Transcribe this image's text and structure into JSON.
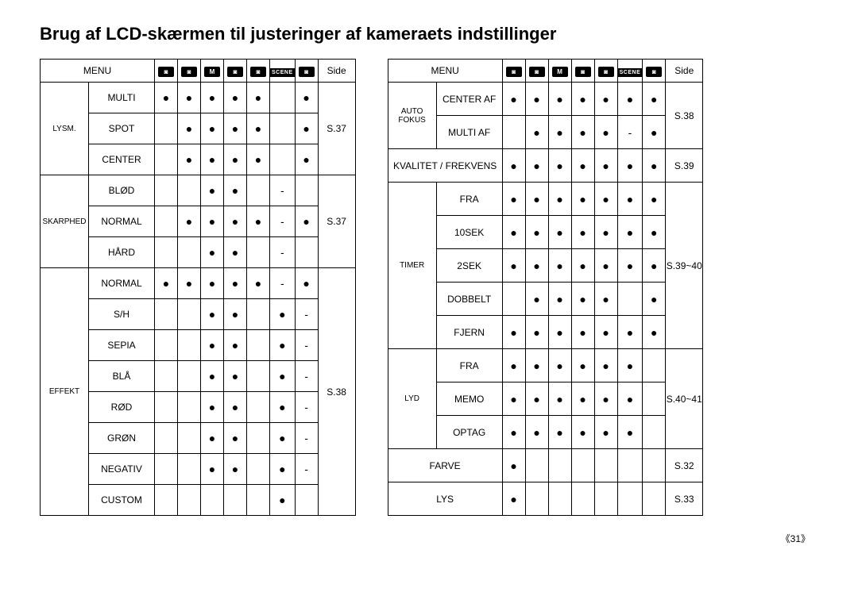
{
  "title": "Brug af LCD-skærmen til justeringer af kameraets indstillinger",
  "header": {
    "menu": "MENU",
    "icons": [
      "◙",
      "◙",
      "M",
      "◙",
      "◙",
      "SCENE",
      "◙"
    ],
    "side": "Side"
  },
  "left": {
    "groups": [
      {
        "cat": "LYSM.",
        "side": "S.37",
        "rows": [
          {
            "name": "MULTI",
            "cells": [
              "●",
              "●",
              "●",
              "●",
              "●",
              "",
              "●"
            ]
          },
          {
            "name": "SPOT",
            "cells": [
              "",
              "●",
              "●",
              "●",
              "●",
              "",
              "●"
            ]
          },
          {
            "name": "CENTER",
            "cells": [
              "",
              "●",
              "●",
              "●",
              "●",
              "",
              "●"
            ]
          }
        ]
      },
      {
        "cat": "SKARPHED",
        "side": "S.37",
        "rows": [
          {
            "name": "BLØD",
            "cells": [
              "",
              "",
              "●",
              "●",
              "",
              "-",
              ""
            ]
          },
          {
            "name": "NORMAL",
            "cells": [
              "",
              "●",
              "●",
              "●",
              "●",
              "-",
              "●"
            ]
          },
          {
            "name": "HÅRD",
            "cells": [
              "",
              "",
              "●",
              "●",
              "",
              "-",
              ""
            ]
          }
        ]
      },
      {
        "cat": "EFFEKT",
        "side": "S.38",
        "rows": [
          {
            "name": "NORMAL",
            "cells": [
              "●",
              "●",
              "●",
              "●",
              "●",
              "-",
              "●"
            ]
          },
          {
            "name": "S/H",
            "cells": [
              "",
              "",
              "●",
              "●",
              "",
              "●",
              "-",
              "●"
            ]
          },
          {
            "name": "SEPIA",
            "cells": [
              "",
              "",
              "●",
              "●",
              "",
              "●",
              "-",
              "●"
            ]
          },
          {
            "name": "BLÅ",
            "cells": [
              "",
              "",
              "●",
              "●",
              "",
              "●",
              "-",
              "●"
            ]
          },
          {
            "name": "RØD",
            "cells": [
              "",
              "",
              "●",
              "●",
              "",
              "●",
              "-",
              "●"
            ]
          },
          {
            "name": "GRØN",
            "cells": [
              "",
              "",
              "●",
              "●",
              "",
              "●",
              "-",
              "●"
            ]
          },
          {
            "name": "NEGATIV",
            "cells": [
              "",
              "",
              "●",
              "●",
              "",
              "●",
              "-",
              "●"
            ]
          },
          {
            "name": "CUSTOM",
            "cells": [
              "",
              "",
              "",
              "",
              "",
              "●",
              "",
              ""
            ]
          }
        ]
      }
    ]
  },
  "right": {
    "groups": [
      {
        "cat": "AUTO FOKUS",
        "side": "S.38",
        "rows": [
          {
            "name": "CENTER AF",
            "cells": [
              "●",
              "●",
              "●",
              "●",
              "●",
              "●",
              "●"
            ]
          },
          {
            "name": "MULTI AF",
            "cells": [
              "",
              "●",
              "●",
              "●",
              "●",
              "-",
              "●"
            ]
          }
        ]
      },
      {
        "cat": "",
        "side": "S.39",
        "full": true,
        "rows": [
          {
            "name": "KVALITET / FREKVENS",
            "cells": [
              "●",
              "●",
              "●",
              "●",
              "●",
              "●",
              "●"
            ]
          }
        ]
      },
      {
        "cat": "TIMER",
        "side": "S.39~40",
        "rows": [
          {
            "name": "FRA",
            "cells": [
              "●",
              "●",
              "●",
              "●",
              "●",
              "●",
              "●"
            ]
          },
          {
            "name": "10SEK",
            "cells": [
              "●",
              "●",
              "●",
              "●",
              "●",
              "●",
              "●"
            ]
          },
          {
            "name": "2SEK",
            "cells": [
              "●",
              "●",
              "●",
              "●",
              "●",
              "●",
              "●"
            ]
          },
          {
            "name": "DOBBELT",
            "cells": [
              "",
              "●",
              "●",
              "●",
              "●",
              "",
              "●"
            ]
          },
          {
            "name": "FJERN",
            "cells": [
              "●",
              "●",
              "●",
              "●",
              "●",
              "●",
              "●"
            ]
          }
        ]
      },
      {
        "cat": "LYD",
        "side": "S.40~41",
        "rows": [
          {
            "name": "FRA",
            "cells": [
              "●",
              "●",
              "●",
              "●",
              "●",
              "●",
              ""
            ]
          },
          {
            "name": "MEMO",
            "cells": [
              "●",
              "●",
              "●",
              "●",
              "●",
              "●",
              ""
            ]
          },
          {
            "name": "OPTAG",
            "cells": [
              "●",
              "●",
              "●",
              "●",
              "●",
              "●",
              ""
            ]
          }
        ]
      },
      {
        "cat": "",
        "side": "S.32",
        "full": true,
        "rows": [
          {
            "name": "FARVE",
            "cells": [
              "●",
              "",
              "",
              "",
              "",
              "",
              ""
            ]
          }
        ]
      },
      {
        "cat": "",
        "side": "S.33",
        "full": true,
        "rows": [
          {
            "name": "LYS",
            "cells": [
              "●",
              "",
              "",
              "",
              "",
              "",
              ""
            ]
          }
        ]
      }
    ]
  },
  "pagenum": "《31》"
}
